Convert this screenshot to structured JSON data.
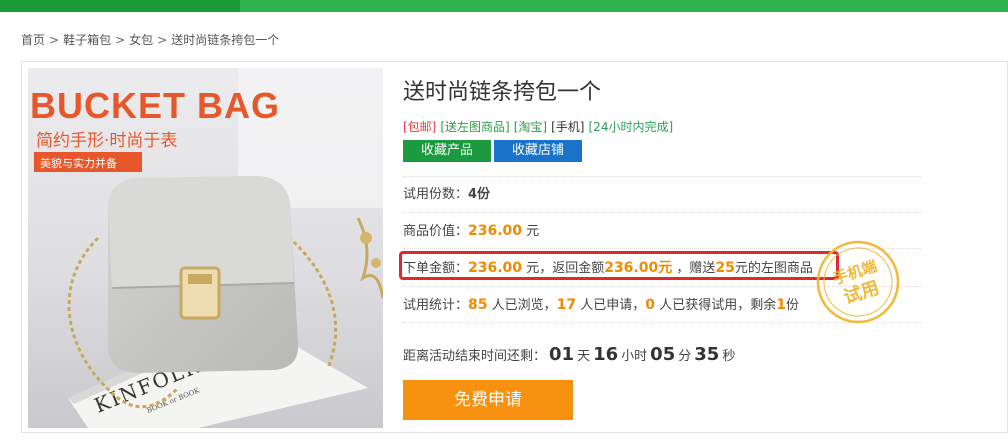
{
  "breadcrumb": {
    "items": [
      "首页",
      "鞋子箱包",
      "女包"
    ],
    "separator": ">",
    "current": "送时尚链条挎包一个"
  },
  "product": {
    "title": "送时尚链条挎包一个",
    "image": {
      "headline": "BUCKET BAG",
      "subline": "简约手形·时尚于表",
      "badge": "美貌与实力并备",
      "book_title": "KINFOLK",
      "book_sub": "BOOK or BOOK"
    },
    "tags": [
      {
        "text": "[包邮]",
        "color": "#e4393c"
      },
      {
        "text": "[送左图商品]",
        "color": "#2f9b44"
      },
      {
        "text": "[淘宝]",
        "color": "#2f9b44"
      },
      {
        "text": "[手机]",
        "color": "#333333"
      },
      {
        "text": "[24小时内完成]",
        "color": "#2aa05a"
      }
    ],
    "buttons": {
      "favorite_product": "收藏产品",
      "favorite_shop": "收藏店铺"
    },
    "trial_count": {
      "label": "试用份数：",
      "value": "4份"
    },
    "price": {
      "label": "商品价值：",
      "value": "236.00",
      "unit": "元"
    },
    "order": {
      "label": "下单金额：",
      "value": "236.00",
      "unit": "元，返回金额",
      "return_value": "236.00元",
      "gift_prefix": "，赠送",
      "gift_value": "25",
      "gift_suffix": "元的左图商品"
    },
    "stats": {
      "label": "试用统计：",
      "views": "85",
      "views_text": "人已浏览，",
      "applies": "17",
      "applies_text": "人已申请，",
      "won": "0",
      "won_text": "人已获得试用，剩余",
      "remaining": "1",
      "remaining_text": "份"
    },
    "countdown": {
      "label": "距离活动结束时间还剩：",
      "days": "01",
      "days_unit": "天",
      "hours": "16",
      "hours_unit": "小时",
      "minutes": "05",
      "minutes_unit": "分",
      "seconds": "35",
      "seconds_unit": "秒"
    },
    "apply_button": "免费申请",
    "stamp": {
      "line1": "手机端",
      "line2": "试用"
    }
  },
  "colors": {
    "accent_green": "#2fb24f",
    "price_orange": "#f08a00",
    "apply_orange": "#f7910f",
    "highlight_red": "#e2282d",
    "stamp_gold": "#f0b93a"
  }
}
